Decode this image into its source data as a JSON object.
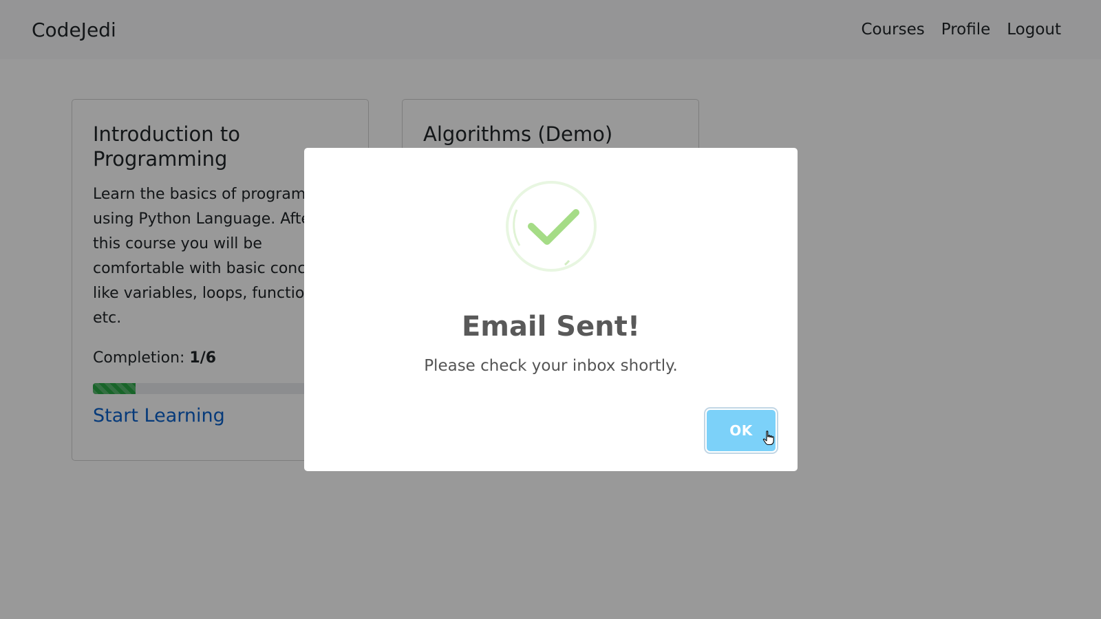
{
  "navbar": {
    "brand": "CodeJedi",
    "links": [
      "Courses",
      "Profile",
      "Logout"
    ]
  },
  "courses": [
    {
      "title": "Introduction to Programming",
      "description": "Learn the basics of programming using Python Language. After this course you will be comfortable with basic concepts like variables, loops, functions, etc.",
      "completion_label": "Completion:",
      "completion_value": "1/6",
      "progress_fraction": 0.1667,
      "link_label": "Start Learning"
    },
    {
      "title": "Algorithms (Demo)"
    }
  ],
  "modal": {
    "icon": "success-check-icon",
    "title": "Email Sent!",
    "text": "Please check your inbox shortly.",
    "ok_label": "OK"
  },
  "colors": {
    "ok_button": "#7cd1f9",
    "check": "#a5dc86",
    "link": "#0b62cc",
    "progress": "#28a745"
  }
}
